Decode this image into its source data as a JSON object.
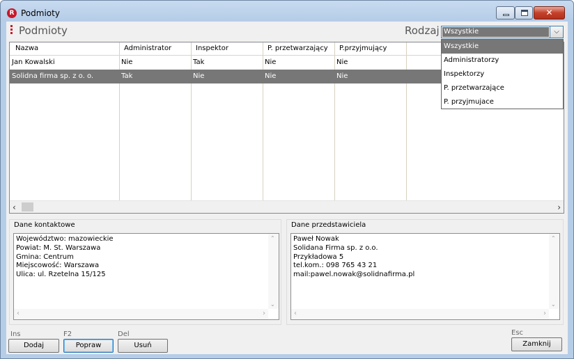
{
  "window": {
    "title": "Podmioty",
    "app_icon_letter": "R"
  },
  "header": {
    "title": "Podmioty",
    "filter_label": "Rodzaj",
    "filter_value": "Wszystkie"
  },
  "dropdown": {
    "options": [
      "Wszystkie",
      "Administratorzy",
      "Inspektorzy",
      "P. przetwarzające",
      "P. przyjmujace"
    ],
    "selected_index": 0
  },
  "table": {
    "columns": [
      "Nazwa",
      "Administrator",
      "Inspektor",
      "P. przetwarzający",
      "P.przyjmujący"
    ],
    "rows": [
      [
        "Jan Kowalski",
        "Nie",
        "Tak",
        "Nie",
        "Nie"
      ],
      [
        "Solidna firma sp. z o. o.",
        "Tak",
        "Nie",
        "Nie",
        "Nie"
      ]
    ],
    "selected_row": 1
  },
  "contact": {
    "label": "Dane kontaktowe",
    "text": "Województwo: mazowieckie\nPowiat: M. St. Warszawa\nGmina: Centrum\nMiejscowość: Warszawa\nUlica: ul. Rzetelna 15/125"
  },
  "representative": {
    "label": "Dane przedstawiciela",
    "text": "Paweł Nowak\nSolidana Firma sp. z o.o.\nPrzykładowa 5\ntel.kom.: 098 765 43 21\nmail:pawel.nowak@solidnafirma.pl"
  },
  "buttons": {
    "add": {
      "hotkey": "Ins",
      "label": "Dodaj"
    },
    "edit": {
      "hotkey": "F2",
      "label": "Popraw"
    },
    "delete": {
      "hotkey": "Del",
      "label": "Usuń"
    },
    "close": {
      "hotkey": "Esc",
      "label": "Zamknij"
    }
  },
  "colors": {
    "accent": "#c8192b",
    "selection": "#777777"
  }
}
